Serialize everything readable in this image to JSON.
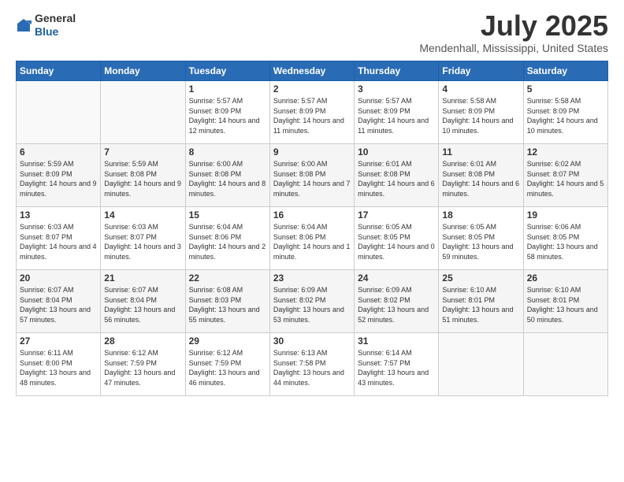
{
  "header": {
    "logo": {
      "general": "General",
      "blue": "Blue"
    },
    "title": "July 2025",
    "location": "Mendenhall, Mississippi, United States"
  },
  "calendar": {
    "weekdays": [
      "Sunday",
      "Monday",
      "Tuesday",
      "Wednesday",
      "Thursday",
      "Friday",
      "Saturday"
    ],
    "weeks": [
      [
        {
          "day": "",
          "empty": true
        },
        {
          "day": "",
          "empty": true
        },
        {
          "day": "1",
          "sunrise": "Sunrise: 5:57 AM",
          "sunset": "Sunset: 8:09 PM",
          "daylight": "Daylight: 14 hours and 12 minutes."
        },
        {
          "day": "2",
          "sunrise": "Sunrise: 5:57 AM",
          "sunset": "Sunset: 8:09 PM",
          "daylight": "Daylight: 14 hours and 11 minutes."
        },
        {
          "day": "3",
          "sunrise": "Sunrise: 5:57 AM",
          "sunset": "Sunset: 8:09 PM",
          "daylight": "Daylight: 14 hours and 11 minutes."
        },
        {
          "day": "4",
          "sunrise": "Sunrise: 5:58 AM",
          "sunset": "Sunset: 8:09 PM",
          "daylight": "Daylight: 14 hours and 10 minutes."
        },
        {
          "day": "5",
          "sunrise": "Sunrise: 5:58 AM",
          "sunset": "Sunset: 8:09 PM",
          "daylight": "Daylight: 14 hours and 10 minutes."
        }
      ],
      [
        {
          "day": "6",
          "sunrise": "Sunrise: 5:59 AM",
          "sunset": "Sunset: 8:09 PM",
          "daylight": "Daylight: 14 hours and 9 minutes."
        },
        {
          "day": "7",
          "sunrise": "Sunrise: 5:59 AM",
          "sunset": "Sunset: 8:08 PM",
          "daylight": "Daylight: 14 hours and 9 minutes."
        },
        {
          "day": "8",
          "sunrise": "Sunrise: 6:00 AM",
          "sunset": "Sunset: 8:08 PM",
          "daylight": "Daylight: 14 hours and 8 minutes."
        },
        {
          "day": "9",
          "sunrise": "Sunrise: 6:00 AM",
          "sunset": "Sunset: 8:08 PM",
          "daylight": "Daylight: 14 hours and 7 minutes."
        },
        {
          "day": "10",
          "sunrise": "Sunrise: 6:01 AM",
          "sunset": "Sunset: 8:08 PM",
          "daylight": "Daylight: 14 hours and 6 minutes."
        },
        {
          "day": "11",
          "sunrise": "Sunrise: 6:01 AM",
          "sunset": "Sunset: 8:08 PM",
          "daylight": "Daylight: 14 hours and 6 minutes."
        },
        {
          "day": "12",
          "sunrise": "Sunrise: 6:02 AM",
          "sunset": "Sunset: 8:07 PM",
          "daylight": "Daylight: 14 hours and 5 minutes."
        }
      ],
      [
        {
          "day": "13",
          "sunrise": "Sunrise: 6:03 AM",
          "sunset": "Sunset: 8:07 PM",
          "daylight": "Daylight: 14 hours and 4 minutes."
        },
        {
          "day": "14",
          "sunrise": "Sunrise: 6:03 AM",
          "sunset": "Sunset: 8:07 PM",
          "daylight": "Daylight: 14 hours and 3 minutes."
        },
        {
          "day": "15",
          "sunrise": "Sunrise: 6:04 AM",
          "sunset": "Sunset: 8:06 PM",
          "daylight": "Daylight: 14 hours and 2 minutes."
        },
        {
          "day": "16",
          "sunrise": "Sunrise: 6:04 AM",
          "sunset": "Sunset: 8:06 PM",
          "daylight": "Daylight: 14 hours and 1 minute."
        },
        {
          "day": "17",
          "sunrise": "Sunrise: 6:05 AM",
          "sunset": "Sunset: 8:05 PM",
          "daylight": "Daylight: 14 hours and 0 minutes."
        },
        {
          "day": "18",
          "sunrise": "Sunrise: 6:05 AM",
          "sunset": "Sunset: 8:05 PM",
          "daylight": "Daylight: 13 hours and 59 minutes."
        },
        {
          "day": "19",
          "sunrise": "Sunrise: 6:06 AM",
          "sunset": "Sunset: 8:05 PM",
          "daylight": "Daylight: 13 hours and 58 minutes."
        }
      ],
      [
        {
          "day": "20",
          "sunrise": "Sunrise: 6:07 AM",
          "sunset": "Sunset: 8:04 PM",
          "daylight": "Daylight: 13 hours and 57 minutes."
        },
        {
          "day": "21",
          "sunrise": "Sunrise: 6:07 AM",
          "sunset": "Sunset: 8:04 PM",
          "daylight": "Daylight: 13 hours and 56 minutes."
        },
        {
          "day": "22",
          "sunrise": "Sunrise: 6:08 AM",
          "sunset": "Sunset: 8:03 PM",
          "daylight": "Daylight: 13 hours and 55 minutes."
        },
        {
          "day": "23",
          "sunrise": "Sunrise: 6:09 AM",
          "sunset": "Sunset: 8:02 PM",
          "daylight": "Daylight: 13 hours and 53 minutes."
        },
        {
          "day": "24",
          "sunrise": "Sunrise: 6:09 AM",
          "sunset": "Sunset: 8:02 PM",
          "daylight": "Daylight: 13 hours and 52 minutes."
        },
        {
          "day": "25",
          "sunrise": "Sunrise: 6:10 AM",
          "sunset": "Sunset: 8:01 PM",
          "daylight": "Daylight: 13 hours and 51 minutes."
        },
        {
          "day": "26",
          "sunrise": "Sunrise: 6:10 AM",
          "sunset": "Sunset: 8:01 PM",
          "daylight": "Daylight: 13 hours and 50 minutes."
        }
      ],
      [
        {
          "day": "27",
          "sunrise": "Sunrise: 6:11 AM",
          "sunset": "Sunset: 8:00 PM",
          "daylight": "Daylight: 13 hours and 48 minutes."
        },
        {
          "day": "28",
          "sunrise": "Sunrise: 6:12 AM",
          "sunset": "Sunset: 7:59 PM",
          "daylight": "Daylight: 13 hours and 47 minutes."
        },
        {
          "day": "29",
          "sunrise": "Sunrise: 6:12 AM",
          "sunset": "Sunset: 7:59 PM",
          "daylight": "Daylight: 13 hours and 46 minutes."
        },
        {
          "day": "30",
          "sunrise": "Sunrise: 6:13 AM",
          "sunset": "Sunset: 7:58 PM",
          "daylight": "Daylight: 13 hours and 44 minutes."
        },
        {
          "day": "31",
          "sunrise": "Sunrise: 6:14 AM",
          "sunset": "Sunset: 7:57 PM",
          "daylight": "Daylight: 13 hours and 43 minutes."
        },
        {
          "day": "",
          "empty": true
        },
        {
          "day": "",
          "empty": true
        }
      ]
    ]
  }
}
